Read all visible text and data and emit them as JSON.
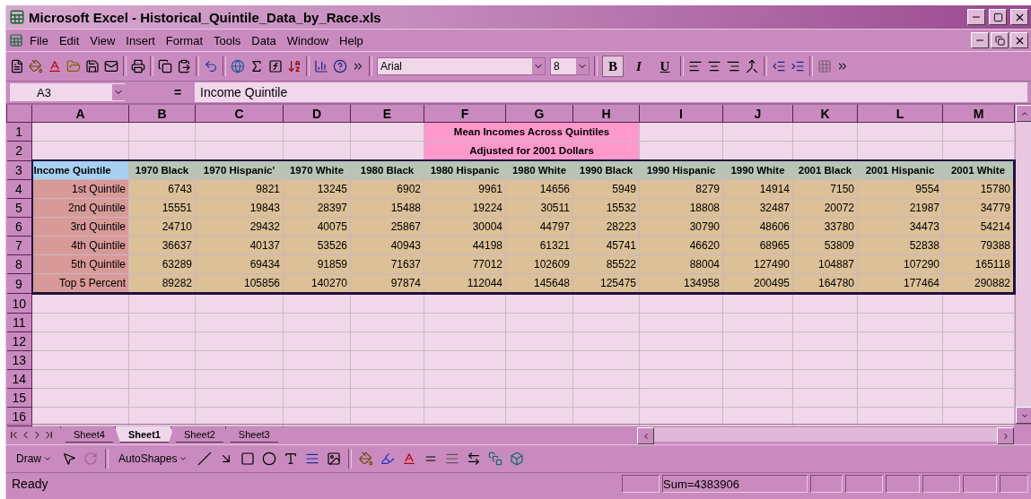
{
  "window": {
    "title": "Microsoft Excel - Historical_Quintile_Data_by_Race.xls"
  },
  "menu_bar": [
    "File",
    "Edit",
    "View",
    "Insert",
    "Format",
    "Tools",
    "Data",
    "Window",
    "Help"
  ],
  "formatting": {
    "font": "Arial",
    "size": "8"
  },
  "style_buttons": [
    {
      "label": "B",
      "pressed": true
    },
    {
      "label": "I",
      "pressed": false
    },
    {
      "label": "U",
      "pressed": false
    }
  ],
  "formula_bar": {
    "name_box": "A3",
    "equals": "=",
    "formula": "Income Quintile"
  },
  "sheet": {
    "columns": [
      "A",
      "B",
      "C",
      "D",
      "E",
      "F",
      "G",
      "H",
      "I",
      "J",
      "K",
      "L",
      "M"
    ],
    "row_numbers": [
      "1",
      "2",
      "3",
      "4",
      "5",
      "6",
      "7",
      "8",
      "9",
      "10",
      "11",
      "12",
      "13",
      "14",
      "15",
      "16"
    ],
    "title_lines": [
      "Mean Incomes Across Quintiles",
      "Adjusted for 2001 Dollars"
    ],
    "header_row": [
      {
        "text": "Income Quintile",
        "selected": true
      },
      {
        "text": "1970 Black",
        "selected": false
      },
      {
        "text": "1970 Hispanic'",
        "selected": false
      },
      {
        "text": "1970 White",
        "selected": false
      },
      {
        "text": "1980 Black",
        "selected": false
      },
      {
        "text": "1980 Hispanic",
        "selected": false
      },
      {
        "text": "1980 White",
        "selected": false
      },
      {
        "text": "1990 Black",
        "selected": false
      },
      {
        "text": "1990 Hispanic",
        "selected": false
      },
      {
        "text": "1990 White",
        "selected": false
      },
      {
        "text": "2001 Black",
        "selected": false
      },
      {
        "text": "2001 Hispanic",
        "selected": false
      },
      {
        "text": "2001 White",
        "selected": false
      }
    ],
    "rows": [
      {
        "label": "1st Quintile",
        "values": [
          "6743",
          "9821",
          "13245",
          "6902",
          "9961",
          "14656",
          "5949",
          "8279",
          "14914",
          "7150",
          "9554",
          "15780"
        ]
      },
      {
        "label": "2nd Quintile",
        "values": [
          "15551",
          "19843",
          "28397",
          "15488",
          "19224",
          "30511",
          "15532",
          "18808",
          "32487",
          "20072",
          "21987",
          "34779"
        ]
      },
      {
        "label": "3rd Quintile",
        "values": [
          "24710",
          "29432",
          "40075",
          "25867",
          "30004",
          "44797",
          "28223",
          "30790",
          "48606",
          "33780",
          "34473",
          "54214"
        ]
      },
      {
        "label": "4th Quintile",
        "values": [
          "36637",
          "40137",
          "53526",
          "40943",
          "44198",
          "61321",
          "45741",
          "46620",
          "68965",
          "53809",
          "52838",
          "79388"
        ]
      },
      {
        "label": "5th Quintile",
        "values": [
          "63289",
          "69434",
          "91859",
          "71637",
          "77012",
          "102609",
          "85522",
          "88004",
          "127490",
          "104887",
          "107290",
          "165118"
        ]
      },
      {
        "label": "Top 5 Percent",
        "values": [
          "89282",
          "105856",
          "140270",
          "97874",
          "112044",
          "145648",
          "125475",
          "134958",
          "200495",
          "164780",
          "177464",
          "290882"
        ]
      }
    ]
  },
  "sheet_tabs": [
    {
      "label": "Sheet4",
      "selected": false
    },
    {
      "label": "Sheet1",
      "selected": true
    },
    {
      "label": "Sheet2",
      "selected": false
    },
    {
      "label": "Sheet3",
      "selected": false
    }
  ],
  "drawing_toolbar": {
    "draw": "Draw",
    "autoshapes": "AutoShapes"
  },
  "status_bar": {
    "state": "Ready",
    "sum": "Sum=4383906"
  }
}
